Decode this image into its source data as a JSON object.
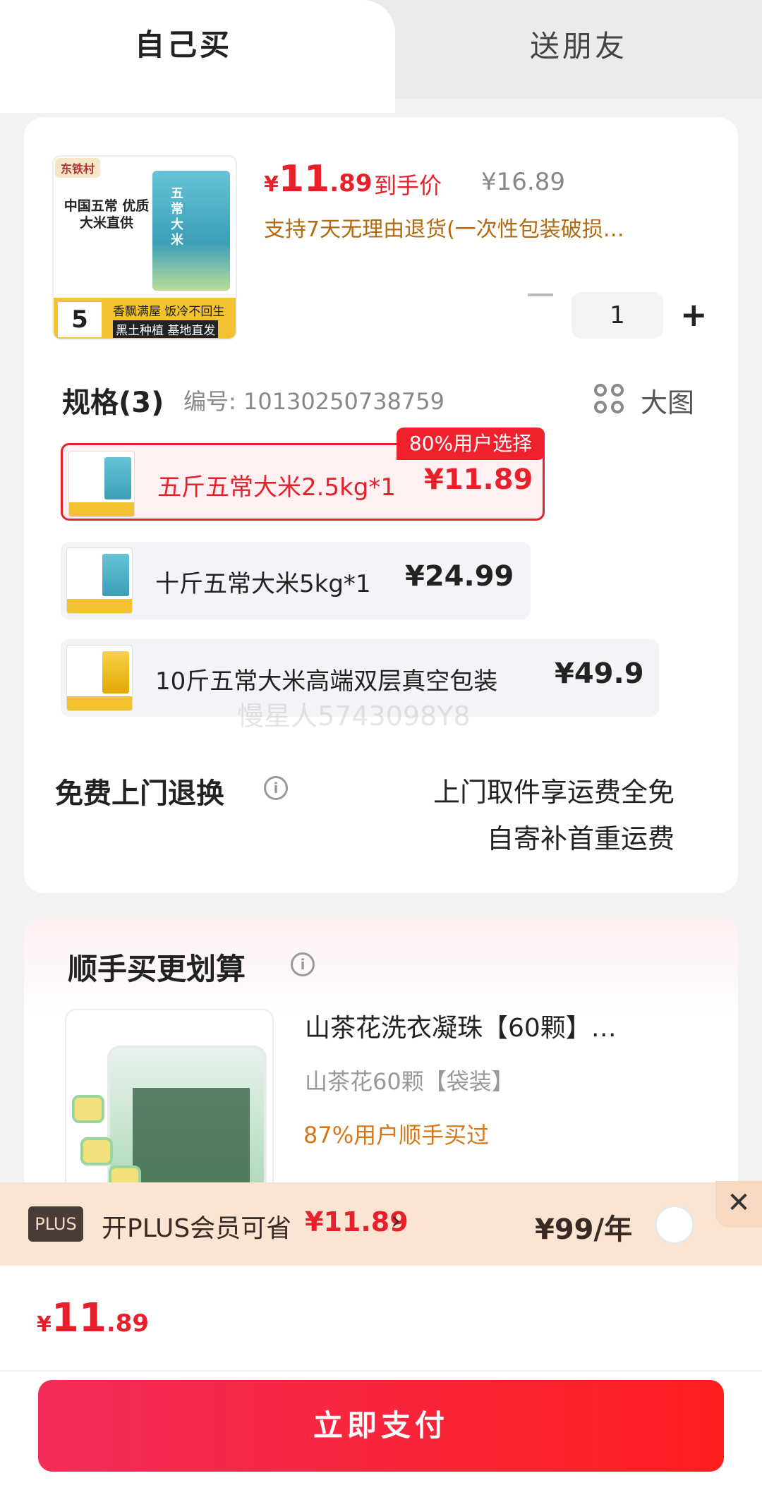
{
  "tabs": {
    "self_buy": "自己买",
    "gift": "送朋友"
  },
  "product": {
    "thumb_logo": "东铁村",
    "thumb_title": "中国五常 优质大米直供",
    "thumb_bag_text": "五常大米",
    "thumb_weight": "5",
    "thumb_slogan": "香飘满屋 饭冷不回生",
    "thumb_slogan2": "黑土种植 基地直发",
    "price_symbol": "¥",
    "price_int": "11",
    "price_dec": ".89",
    "price_tag": "到手价",
    "price_original": "¥16.89",
    "return_note": "支持7天无理由退货(一次性包装破损…",
    "quantity": "1"
  },
  "spec": {
    "title": "规格(3)",
    "code": "编号: 10130250738759",
    "big_image_label": "大图",
    "badge": "80%用户选择",
    "options": [
      {
        "name": "五斤五常大米2.5kg*1",
        "price": "¥11.89",
        "selected": true
      },
      {
        "name": "十斤五常大米5kg*1",
        "price": "¥24.99",
        "selected": false
      },
      {
        "name": "10斤五常大米高端双层真空包装",
        "price": "¥49.9",
        "selected": false
      }
    ]
  },
  "watermark": "慢星人574309​8Y8",
  "return_service": {
    "title": "免费上门退换",
    "line1": "上门取件享运费全免",
    "line2": "自寄补首重运费"
  },
  "bundle": {
    "title": "顺手买更划算",
    "item_name": "山茶花洗衣凝珠【60颗】…",
    "item_sku": "山茶花60颗【袋装】",
    "item_bought": "87%用户顺手买过"
  },
  "plus": {
    "badge": "PLUS",
    "text": "开PLUS会员可省",
    "save": "¥11.89",
    "chevron": "›",
    "price": "¥99/年",
    "close": "✕"
  },
  "checkout": {
    "total_symbol": "¥",
    "total_int": "11",
    "total_dec": ".89",
    "pay_label": "立即支付"
  },
  "colors": {
    "accent_red": "#e8202b",
    "plus_bg": "#fbe4d2",
    "note_brown": "#b26a10"
  }
}
